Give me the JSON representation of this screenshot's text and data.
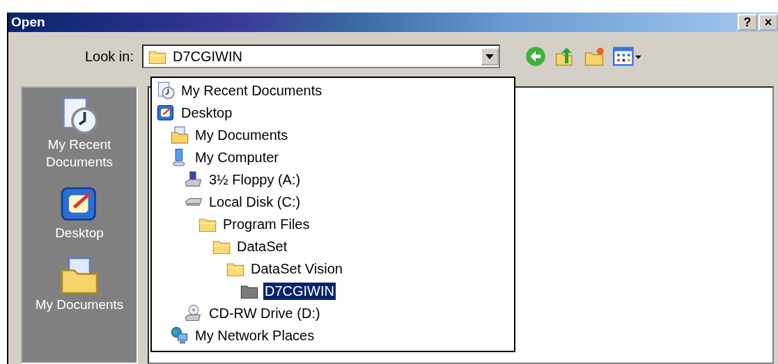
{
  "window": {
    "title": "Open",
    "title_buttons": [
      "?",
      "×"
    ]
  },
  "look_in": {
    "label": "Look in:",
    "value": "D7CGIWIN",
    "expanded": true
  },
  "toolbar": [
    {
      "kind": "back"
    },
    {
      "kind": "up"
    },
    {
      "kind": "new-folder"
    },
    {
      "kind": "views"
    }
  ],
  "places_bar": [
    {
      "kind": "recent",
      "label": "My Recent Documents"
    },
    {
      "kind": "desktop",
      "label": "Desktop"
    },
    {
      "kind": "documents",
      "label": "My Documents"
    }
  ],
  "look_in_list": [
    {
      "kind": "recent",
      "label": "My Recent Documents",
      "selected": false
    },
    {
      "kind": "desktop",
      "label": "Desktop",
      "selected": false,
      "children": [
        {
          "kind": "documents",
          "label": "My Documents",
          "selected": false
        },
        {
          "kind": "computer",
          "label": "My Computer",
          "selected": false,
          "children": [
            {
              "kind": "floppy",
              "label": "3½ Floppy (A:)",
              "selected": false
            },
            {
              "kind": "disk",
              "label": "Local Disk (C:)",
              "selected": false,
              "children": [
                {
                  "kind": "folder",
                  "label": "Program Files",
                  "selected": false,
                  "children": [
                    {
                      "kind": "folder",
                      "label": "DataSet",
                      "selected": false,
                      "children": [
                        {
                          "kind": "folder",
                          "label": "DataSet Vision",
                          "selected": false,
                          "children": [
                            {
                              "kind": "folder-dark",
                              "label": "D7CGIWIN",
                              "selected": true
                            }
                          ]
                        }
                      ]
                    }
                  ]
                }
              ]
            },
            {
              "kind": "cdrom",
              "label": "CD-RW Drive (D:)",
              "selected": false
            }
          ]
        },
        {
          "kind": "network",
          "label": "My Network Places",
          "selected": false
        }
      ]
    }
  ]
}
